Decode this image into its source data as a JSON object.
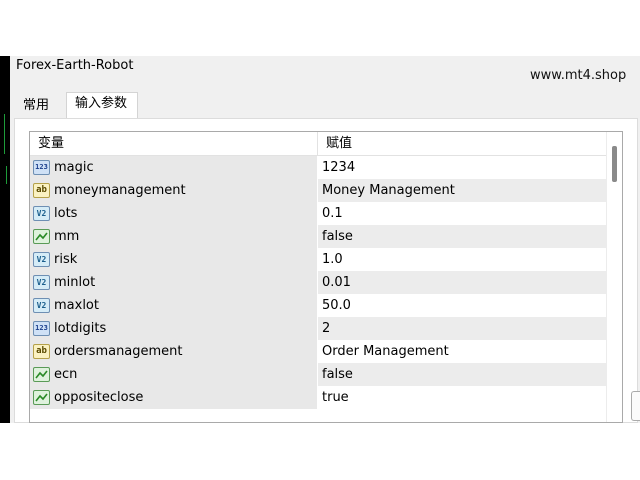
{
  "window": {
    "title": "Forex-Earth-Robot"
  },
  "watermark": "www.mt4.shop",
  "tabs": [
    {
      "label": "常用",
      "active": false
    },
    {
      "label": "输入参数",
      "active": true
    }
  ],
  "table": {
    "headers": {
      "variable": "变量",
      "value": "赋值"
    },
    "rows": [
      {
        "icon": "int-type-icon",
        "badge": "123",
        "name": "magic",
        "value": "1234"
      },
      {
        "icon": "string-type-icon",
        "badge": "ab",
        "name": "moneymanagement",
        "value": "Money Management"
      },
      {
        "icon": "double-type-icon",
        "badge": "V2",
        "name": "lots",
        "value": "0.1"
      },
      {
        "icon": "bool-type-icon",
        "badge": "",
        "name": "mm",
        "value": "false"
      },
      {
        "icon": "double-type-icon",
        "badge": "V2",
        "name": "risk",
        "value": "1.0"
      },
      {
        "icon": "double-type-icon",
        "badge": "V2",
        "name": "minlot",
        "value": "0.01"
      },
      {
        "icon": "double-type-icon",
        "badge": "V2",
        "name": "maxlot",
        "value": "50.0"
      },
      {
        "icon": "int-type-icon",
        "badge": "123",
        "name": "lotdigits",
        "value": "2"
      },
      {
        "icon": "string-type-icon",
        "badge": "ab",
        "name": "ordersmanagement",
        "value": "Order Management"
      },
      {
        "icon": "bool-type-icon",
        "badge": "",
        "name": "ecn",
        "value": "false"
      },
      {
        "icon": "bool-type-icon",
        "badge": "",
        "name": "oppositeclose",
        "value": "true"
      }
    ]
  },
  "colors": {
    "name_cell": "#e8e8e8",
    "alt_value_cell": "#ececec",
    "dialog_bg": "#f0f0f0"
  }
}
